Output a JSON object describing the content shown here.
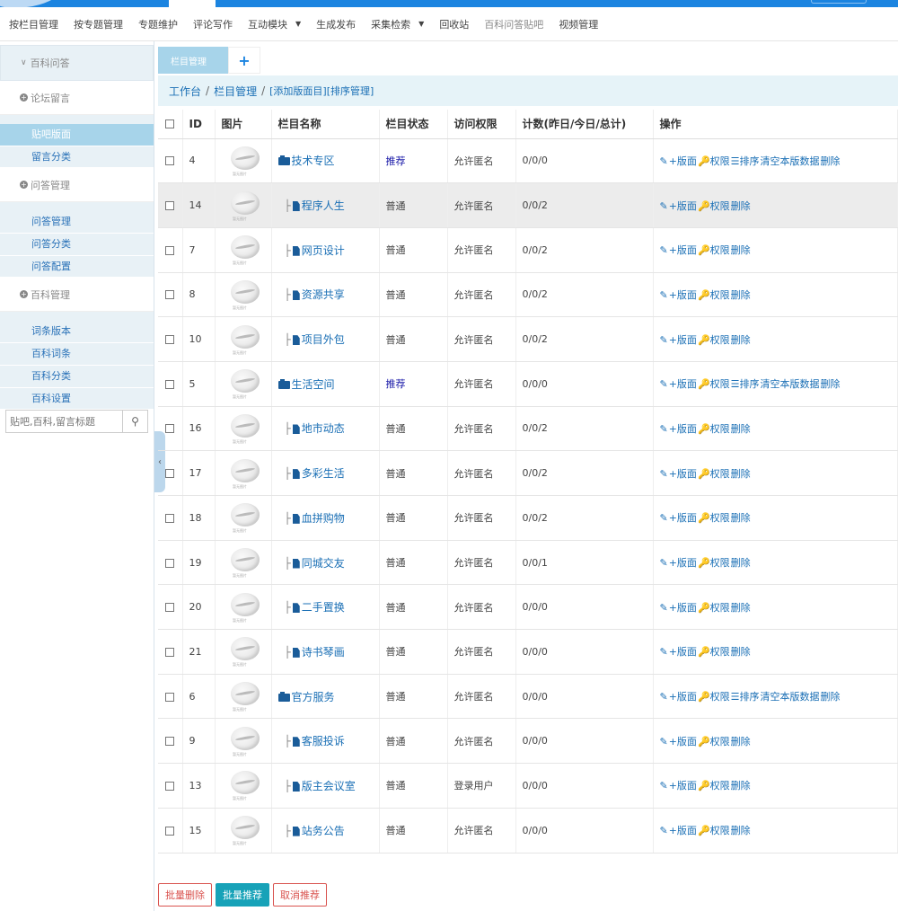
{
  "subnav": [
    {
      "label": "按栏目管理",
      "dim": false
    },
    {
      "label": "按专题管理",
      "dim": false
    },
    {
      "label": "专题维护",
      "dim": false
    },
    {
      "label": "评论写作",
      "dim": false
    },
    {
      "label": "互动模块",
      "dim": false,
      "caret": true
    },
    {
      "label": "生成发布",
      "dim": false
    },
    {
      "label": "采集检索",
      "dim": false,
      "caret": true
    },
    {
      "label": "回收站",
      "dim": false
    },
    {
      "label": "百科问答贴吧",
      "dim": true
    },
    {
      "label": "视频管理",
      "dim": false
    }
  ],
  "sidebar": {
    "head": "百科问答",
    "groups": [
      {
        "title": "论坛留言",
        "links": [
          {
            "label": "贴吧版面",
            "active": true
          },
          {
            "label": "留言分类",
            "active": false
          }
        ]
      },
      {
        "title": "问答管理",
        "links": [
          {
            "label": "问答管理",
            "active": false
          },
          {
            "label": "问答分类",
            "active": false
          },
          {
            "label": "问答配置",
            "active": false
          }
        ]
      },
      {
        "title": "百科管理",
        "links": [
          {
            "label": "词条版本",
            "active": false
          },
          {
            "label": "百科词条",
            "active": false
          },
          {
            "label": "百科分类",
            "active": false
          },
          {
            "label": "百科设置",
            "active": false
          }
        ]
      }
    ],
    "search_placeholder": "贴吧,百科,留言标题"
  },
  "tabs": {
    "active": "栏目管理",
    "add": "+"
  },
  "breadcrumb": {
    "home": "工作台",
    "section": "栏目管理",
    "add": "[添加版面目]",
    "sort": "[排序管理]",
    "sep": "/"
  },
  "table": {
    "headers": [
      "ID",
      "图片",
      "栏目名称",
      "栏目状态",
      "访问权限",
      "计数(昨日/今日/总计)",
      "操作"
    ],
    "thumb_caption": "暂无图片",
    "ops_full": [
      "✎",
      "+版面",
      "🔑权限",
      "☰排序",
      "清空本版数据",
      "删除"
    ],
    "ops_short": [
      "✎",
      "+版面",
      "🔑权限",
      "删除"
    ],
    "rows": [
      {
        "id": "4",
        "name": "技术专区",
        "type": "folder",
        "status": "推荐",
        "access": "允许匿名",
        "count": "0/0/0",
        "full": true,
        "hl": false
      },
      {
        "id": "14",
        "name": "程序人生",
        "type": "file",
        "status": "普通",
        "access": "允许匿名",
        "count": "0/0/2",
        "full": false,
        "hl": true
      },
      {
        "id": "7",
        "name": "网页设计",
        "type": "file",
        "status": "普通",
        "access": "允许匿名",
        "count": "0/0/2",
        "full": false,
        "hl": false
      },
      {
        "id": "8",
        "name": "资源共享",
        "type": "file",
        "status": "普通",
        "access": "允许匿名",
        "count": "0/0/2",
        "full": false,
        "hl": false
      },
      {
        "id": "10",
        "name": "项目外包",
        "type": "file",
        "status": "普通",
        "access": "允许匿名",
        "count": "0/0/2",
        "full": false,
        "hl": false
      },
      {
        "id": "5",
        "name": "生活空间",
        "type": "folder",
        "status": "推荐",
        "access": "允许匿名",
        "count": "0/0/0",
        "full": true,
        "hl": false
      },
      {
        "id": "16",
        "name": "地市动态",
        "type": "file",
        "status": "普通",
        "access": "允许匿名",
        "count": "0/0/2",
        "full": false,
        "hl": false
      },
      {
        "id": "17",
        "name": "多彩生活",
        "type": "file",
        "status": "普通",
        "access": "允许匿名",
        "count": "0/0/2",
        "full": false,
        "hl": false
      },
      {
        "id": "18",
        "name": "血拼购物",
        "type": "file",
        "status": "普通",
        "access": "允许匿名",
        "count": "0/0/2",
        "full": false,
        "hl": false
      },
      {
        "id": "19",
        "name": "同城交友",
        "type": "file",
        "status": "普通",
        "access": "允许匿名",
        "count": "0/0/1",
        "full": false,
        "hl": false
      },
      {
        "id": "20",
        "name": "二手置换",
        "type": "file",
        "status": "普通",
        "access": "允许匿名",
        "count": "0/0/0",
        "full": false,
        "hl": false
      },
      {
        "id": "21",
        "name": "诗书琴画",
        "type": "file",
        "status": "普通",
        "access": "允许匿名",
        "count": "0/0/0",
        "full": false,
        "hl": false
      },
      {
        "id": "6",
        "name": "官方服务",
        "type": "folder",
        "status": "普通",
        "access": "允许匿名",
        "count": "0/0/0",
        "full": true,
        "hl": false
      },
      {
        "id": "9",
        "name": "客服投诉",
        "type": "file",
        "status": "普通",
        "access": "允许匿名",
        "count": "0/0/0",
        "full": false,
        "hl": false
      },
      {
        "id": "13",
        "name": "版主会议室",
        "type": "file",
        "status": "普通",
        "access": "登录用户",
        "count": "0/0/0",
        "full": false,
        "hl": false
      },
      {
        "id": "15",
        "name": "站务公告",
        "type": "file",
        "status": "普通",
        "access": "允许匿名",
        "count": "0/0/0",
        "full": false,
        "hl": false
      }
    ]
  },
  "footer": {
    "delete": "批量删除",
    "recommend": "批量推荐",
    "cancel": "取消推荐"
  },
  "colors": {
    "primary": "#1b84e0",
    "link": "#1a6fb5",
    "active_bg": "#a7d4ea",
    "teal": "#17a2b8",
    "danger": "#d9534f"
  }
}
